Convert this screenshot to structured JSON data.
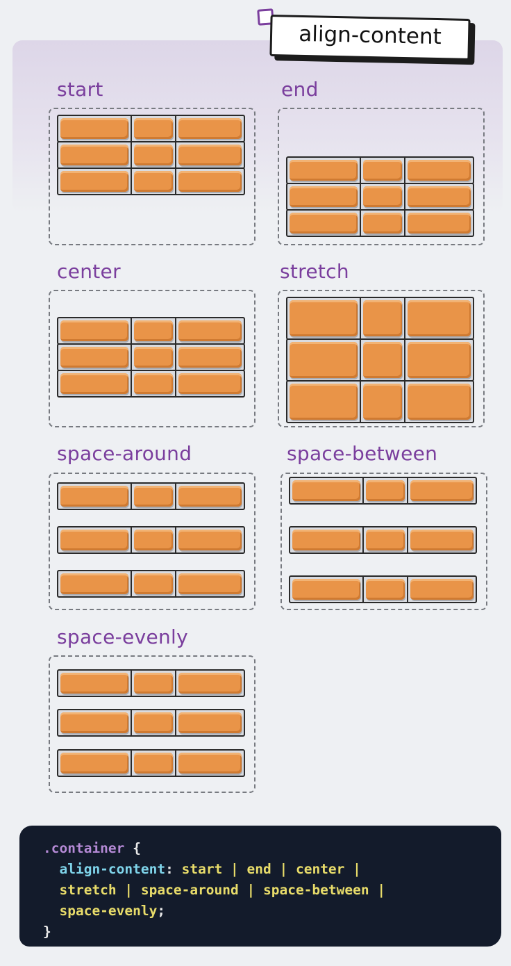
{
  "title": "align-content",
  "examples": [
    {
      "label": "start",
      "align": "start"
    },
    {
      "label": "end",
      "align": "end"
    },
    {
      "label": "center",
      "align": "center"
    },
    {
      "label": "stretch",
      "align": "stretch"
    },
    {
      "label": "space-around",
      "align": "space-around"
    },
    {
      "label": "space-between",
      "align": "space-between"
    },
    {
      "label": "space-evenly",
      "align": "space-evenly"
    }
  ],
  "code": {
    "selector": ".container",
    "open_brace": "{",
    "property": "align-content",
    "colon": ":",
    "values_line1": "start | end | center |",
    "values_line2": "stretch | space-around | space-between |",
    "values_line3": "space-evenly",
    "semicolon": ";",
    "close_brace": "}"
  },
  "colors": {
    "label_purple": "#7a3e9d",
    "brick_orange": "#e99448",
    "code_background": "#131b2b"
  }
}
